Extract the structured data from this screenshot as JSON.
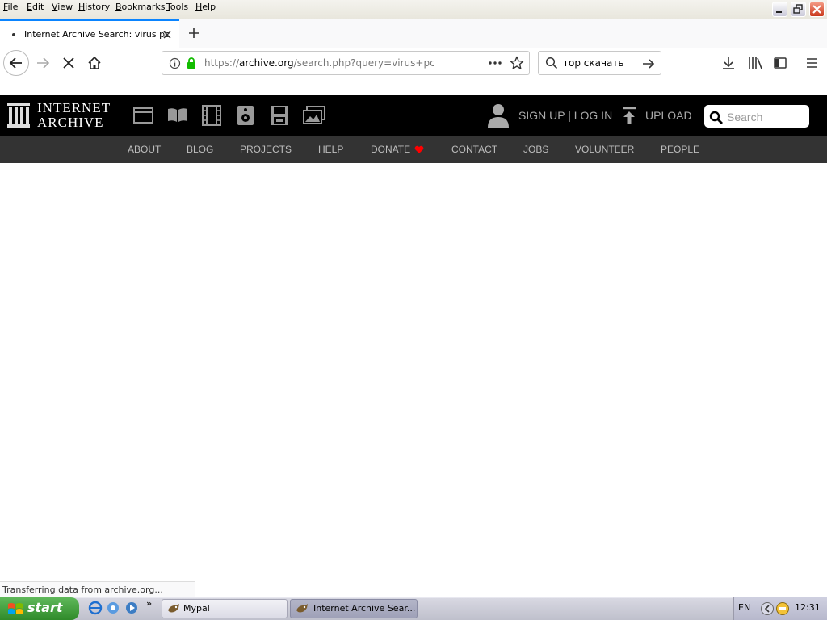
{
  "menubar": {
    "items": [
      {
        "label": "File",
        "key": "F",
        "rest": "ile"
      },
      {
        "label": "Edit",
        "key": "E",
        "rest": "dit"
      },
      {
        "label": "View",
        "key": "V",
        "rest": "iew"
      },
      {
        "label": "History",
        "key": "H",
        "rest": "istory"
      },
      {
        "label": "Bookmarks",
        "key": "B",
        "rest": "ookmarks"
      },
      {
        "label": "Tools",
        "key": "T",
        "rest": "ools"
      },
      {
        "label": "Help",
        "key": "H",
        "rest": "elp"
      }
    ]
  },
  "tabs": [
    {
      "title": "Internet Archive Search: virus pc",
      "loading": true
    }
  ],
  "navbar": {
    "url_prefix": "https://",
    "url_domain": "archive.org",
    "url_path": "/search.php?query=virus+pc",
    "search_value": "тор скачать"
  },
  "ia": {
    "logo_line1": "INTERNET",
    "logo_line2": "ARCHIVE",
    "signup_login": "SIGN UP | LOG IN",
    "upload": "UPLOAD",
    "search_placeholder": "Search",
    "media_icons": [
      "web-icon",
      "texts-icon",
      "video-icon",
      "audio-icon",
      "software-icon",
      "images-icon"
    ],
    "nav": [
      "ABOUT",
      "BLOG",
      "PROJECTS",
      "HELP",
      "DONATE",
      "CONTACT",
      "JOBS",
      "VOLUNTEER",
      "PEOPLE"
    ],
    "donate_heart_color": "#ff0000"
  },
  "status": {
    "text": "Transferring data from archive.org..."
  },
  "taskbar": {
    "start": "start",
    "items": [
      "Mypal",
      "Internet Archive Sear..."
    ],
    "lang": "EN",
    "clock": "12:31"
  }
}
